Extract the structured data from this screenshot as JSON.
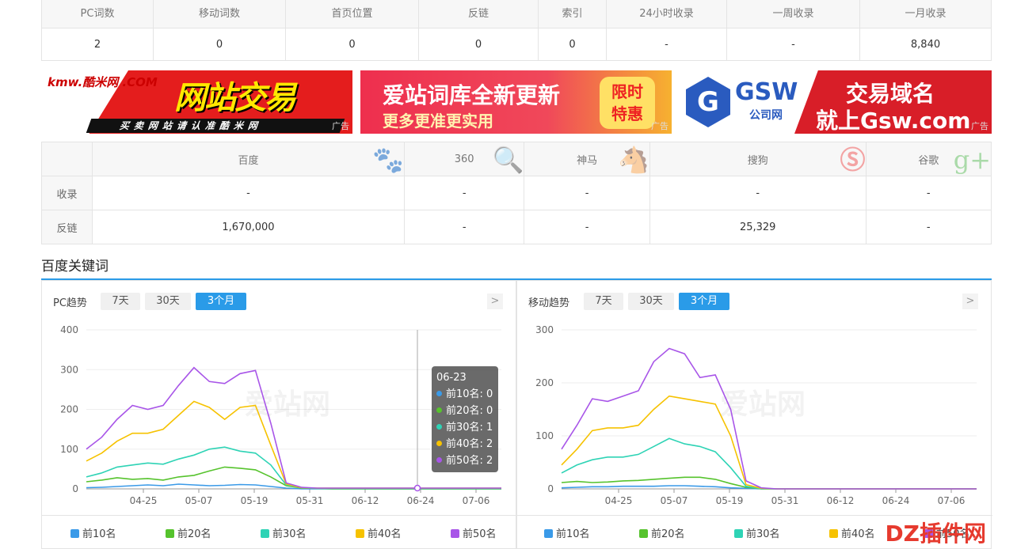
{
  "stats": {
    "headers": [
      "PC词数",
      "移动词数",
      "首页位置",
      "反链",
      "索引",
      "24小时收录",
      "一周收录",
      "一月收录"
    ],
    "values": [
      "2",
      "0",
      "0",
      "0",
      "0",
      "-",
      "-",
      "8,840"
    ]
  },
  "ads": {
    "ad1": {
      "logo": "kmw.酷米网 .COM",
      "headline": "网站交易",
      "sub": "买卖网站请认准酷米网",
      "tag": "广告"
    },
    "ad2": {
      "line1": "爱站词库全新更新",
      "line2": "更多更准更实用",
      "badge1": "限时",
      "badge2": "特惠",
      "tag": "广告"
    },
    "ad3": {
      "brand": "GSW",
      "brand_sub": "公司网",
      "line1": "交易域名",
      "line2": "就上Gsw.com",
      "tag": "广告",
      "hex_letter": "G"
    }
  },
  "engines": {
    "headers": [
      "百度",
      "360",
      "神马",
      "搜狗",
      "谷歌"
    ],
    "icons": [
      "paw-icon",
      "search-icon",
      "shenma-icon",
      "sogou-icon",
      "google-plus-icon"
    ],
    "rows": [
      {
        "label": "收录",
        "values": [
          "-",
          "-",
          "-",
          "-",
          "-"
        ]
      },
      {
        "label": "反链",
        "values": [
          "1,670,000",
          "-",
          "-",
          "25,329",
          "-"
        ]
      }
    ]
  },
  "section_title": "百度关键词",
  "pc_panel": {
    "title": "PC趋势",
    "tabs": [
      "7天",
      "30天",
      "3个月"
    ],
    "active_tab": "3个月"
  },
  "mobile_panel": {
    "title": "移动趋势",
    "tabs": [
      "7天",
      "30天",
      "3个月"
    ],
    "active_tab": "3个月"
  },
  "tooltip": {
    "date": "06-23",
    "rows": [
      "前10名: 0",
      "前20名: 0",
      "前30名: 1",
      "前40名: 2",
      "前50名: 2"
    ]
  },
  "legend": [
    "前10名",
    "前20名",
    "前30名",
    "前40名",
    "前50名"
  ],
  "colors": {
    "top10": "#3a9ae8",
    "top20": "#56c32d",
    "top30": "#2ed3b5",
    "top40": "#f6c200",
    "top50": "#a855e8",
    "accent": "#2a9be8"
  },
  "watermark": "爱站网",
  "corner_logo": {
    "text1": "DZ",
    "text2": "插件网",
    "sub": "DZ-X.NET"
  },
  "chart_data": [
    {
      "type": "line",
      "title": "PC趋势",
      "x_ticks": [
        "04-25",
        "05-07",
        "05-19",
        "05-31",
        "06-12",
        "06-24",
        "07-06"
      ],
      "ylim": [
        0,
        400
      ],
      "y_ticks": [
        0,
        100,
        200,
        300,
        400
      ],
      "series": [
        {
          "name": "前10名",
          "values": [
            3,
            4,
            6,
            8,
            10,
            8,
            12,
            10,
            8,
            9,
            11,
            10,
            6,
            2,
            0,
            0,
            0,
            0,
            0,
            0,
            0,
            0,
            0,
            0,
            0,
            0,
            0,
            0
          ]
        },
        {
          "name": "前20名",
          "values": [
            18,
            22,
            28,
            24,
            26,
            22,
            30,
            34,
            45,
            55,
            52,
            48,
            30,
            8,
            2,
            1,
            0,
            0,
            0,
            0,
            0,
            0,
            0,
            0,
            0,
            0,
            0,
            0
          ]
        },
        {
          "name": "前30名",
          "values": [
            30,
            40,
            55,
            60,
            65,
            62,
            75,
            85,
            100,
            105,
            95,
            90,
            60,
            10,
            3,
            1,
            1,
            1,
            1,
            1,
            1,
            1,
            1,
            1,
            1,
            1,
            1,
            1
          ]
        },
        {
          "name": "前40名",
          "values": [
            70,
            90,
            120,
            140,
            140,
            150,
            185,
            220,
            205,
            175,
            205,
            210,
            110,
            12,
            3,
            2,
            2,
            2,
            2,
            2,
            2,
            2,
            2,
            2,
            2,
            2,
            2,
            2
          ]
        },
        {
          "name": "前50名",
          "values": [
            100,
            130,
            175,
            210,
            200,
            210,
            260,
            305,
            270,
            265,
            290,
            298,
            165,
            15,
            4,
            2,
            2,
            2,
            2,
            2,
            2,
            2,
            2,
            2,
            2,
            2,
            2,
            2
          ]
        }
      ]
    },
    {
      "type": "line",
      "title": "移动趋势",
      "x_ticks": [
        "04-25",
        "05-07",
        "05-19",
        "05-31",
        "06-12",
        "06-24",
        "07-06"
      ],
      "ylim": [
        0,
        300
      ],
      "y_ticks": [
        0,
        100,
        200,
        300
      ],
      "series": [
        {
          "name": "前10名",
          "values": [
            2,
            3,
            4,
            4,
            5,
            5,
            5,
            6,
            6,
            5,
            4,
            2,
            1,
            0,
            0,
            0,
            0,
            0,
            0,
            0,
            0,
            0,
            0,
            0,
            0,
            0,
            0,
            0
          ]
        },
        {
          "name": "前20名",
          "values": [
            12,
            14,
            12,
            13,
            15,
            16,
            18,
            20,
            22,
            22,
            18,
            10,
            3,
            0,
            0,
            0,
            0,
            0,
            0,
            0,
            0,
            0,
            0,
            0,
            0,
            0,
            0,
            0
          ]
        },
        {
          "name": "前30名",
          "values": [
            30,
            45,
            55,
            60,
            60,
            65,
            80,
            95,
            85,
            80,
            70,
            40,
            5,
            0,
            0,
            0,
            0,
            0,
            0,
            0,
            0,
            0,
            0,
            0,
            0,
            0,
            0,
            0
          ]
        },
        {
          "name": "前40名",
          "values": [
            45,
            75,
            110,
            115,
            115,
            120,
            150,
            175,
            170,
            165,
            160,
            100,
            8,
            1,
            0,
            0,
            0,
            0,
            0,
            0,
            0,
            0,
            0,
            0,
            0,
            0,
            0,
            0
          ]
        },
        {
          "name": "前50名",
          "values": [
            75,
            120,
            170,
            165,
            175,
            185,
            240,
            265,
            255,
            210,
            215,
            150,
            15,
            2,
            0,
            0,
            0,
            0,
            0,
            0,
            0,
            0,
            0,
            0,
            0,
            0,
            0,
            0
          ]
        }
      ]
    }
  ]
}
